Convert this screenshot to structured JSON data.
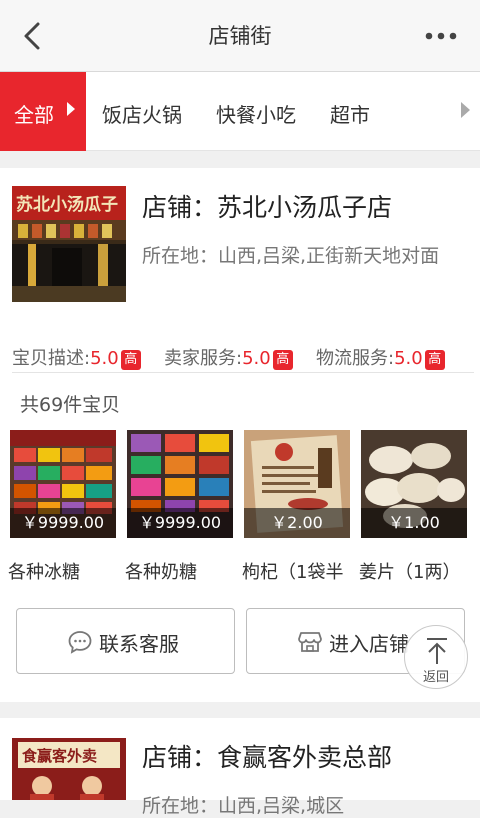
{
  "header": {
    "title": "店铺街",
    "back_icon": "chevron-left-icon",
    "more_icon": "more-dots-icon"
  },
  "tabs": [
    {
      "label": "全部",
      "active": true
    },
    {
      "label": "饭店火锅"
    },
    {
      "label": "快餐小吃"
    },
    {
      "label": "超市"
    }
  ],
  "colors": {
    "accent": "#e8262d",
    "background": "#f0f0f0"
  },
  "shops": [
    {
      "name": "店铺：苏北小汤瓜子店",
      "location": "所在地：山西,吕梁,正街新天地对面",
      "sign_text": "苏北小汤瓜子",
      "ratings": [
        {
          "label": "宝贝描述:",
          "value": "5.0",
          "badge": "高"
        },
        {
          "label": "卖家服务:",
          "value": "5.0",
          "badge": "高"
        },
        {
          "label": "物流服务:",
          "value": "5.0",
          "badge": "高"
        }
      ],
      "product_count": "共69件宝贝",
      "products": [
        {
          "price": "￥9999.00",
          "name": "各种冰糖"
        },
        {
          "price": "￥9999.00",
          "name": "各种奶糖"
        },
        {
          "price": "￥2.00",
          "name": "枸杞（1袋半"
        },
        {
          "price": "￥1.00",
          "name": "姜片（1两）"
        }
      ],
      "buttons": {
        "contact": "联系客服",
        "enter": "进入店铺"
      }
    },
    {
      "name": "店铺：食赢客外卖总部",
      "location": "所在地：山西,吕梁,城区",
      "sign_text": "食赢客外卖"
    }
  ],
  "back_to_top": {
    "label": "返回"
  }
}
